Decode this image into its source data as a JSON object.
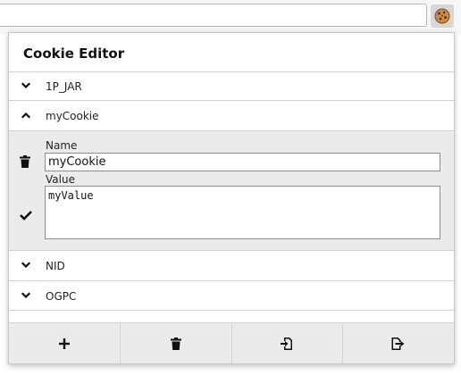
{
  "browser": {
    "extension_icon": "cookie-icon"
  },
  "popup": {
    "title": "Cookie Editor"
  },
  "cookies": [
    {
      "name": "1P_JAR",
      "expanded": false
    },
    {
      "name": "myCookie",
      "expanded": true
    },
    {
      "name": "NID",
      "expanded": false
    },
    {
      "name": "OGPC",
      "expanded": false
    }
  ],
  "editor": {
    "name_label": "Name",
    "name_value": "myCookie",
    "value_label": "Value",
    "value_value": "myValue",
    "delete_icon": "trash-icon",
    "save_icon": "checkmark-icon"
  },
  "footer": {
    "buttons": [
      {
        "icon": "plus-icon"
      },
      {
        "icon": "trash-icon"
      },
      {
        "icon": "import-icon"
      },
      {
        "icon": "export-icon"
      }
    ]
  },
  "colors": {
    "panel_background": "#ebebeb",
    "border": "#d3d3d3"
  }
}
